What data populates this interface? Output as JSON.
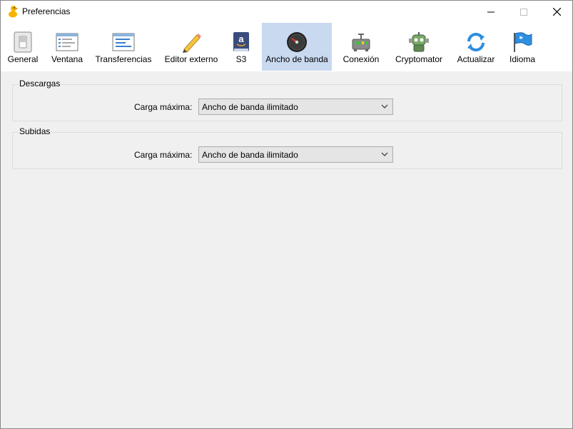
{
  "window": {
    "title": "Preferencias"
  },
  "toolbar": {
    "items": [
      {
        "label": "General",
        "icon": "switch-icon"
      },
      {
        "label": "Ventana",
        "icon": "window-icon"
      },
      {
        "label": "Transferencias",
        "icon": "transfers-icon"
      },
      {
        "label": "Editor externo",
        "icon": "pencil-icon"
      },
      {
        "label": "S3",
        "icon": "s3-book-icon"
      },
      {
        "label": "Ancho de banda",
        "icon": "gauge-icon",
        "selected": true
      },
      {
        "label": "Conexión",
        "icon": "network-icon"
      },
      {
        "label": "Cryptomator",
        "icon": "robot-icon"
      },
      {
        "label": "Actualizar",
        "icon": "refresh-icon"
      },
      {
        "label": "Idioma",
        "icon": "flag-icon"
      }
    ]
  },
  "downloads": {
    "title": "Descargas",
    "label": "Carga máxima:",
    "value": "Ancho de banda ilimitado"
  },
  "uploads": {
    "title": "Subidas",
    "label": "Carga máxima:",
    "value": "Ancho de banda ilimitado"
  },
  "colors": {
    "selected_tab": "#c9d9f0",
    "background": "#f0f0f0"
  }
}
